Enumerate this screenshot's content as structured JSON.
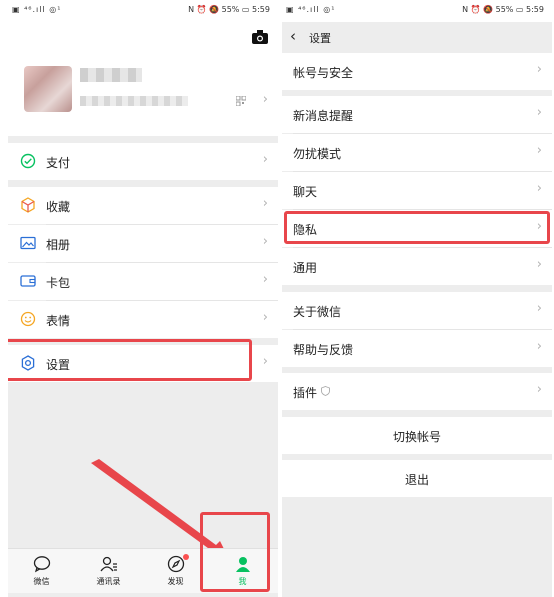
{
  "status": {
    "left_icons": "▣ ⁴⁶.ıll ◎¹",
    "right_text": "N ⏰ 🔕 55% ▭ 5:59"
  },
  "colors": {
    "wechat_green": "#07c160",
    "annotation_red": "#e8464b",
    "chevron_gray": "#b2b2b2",
    "badge_red": "#fa5151"
  },
  "me_page": {
    "menu": [
      {
        "label": "支付",
        "icon": "pay-icon"
      },
      {
        "label": "收藏",
        "icon": "favorites-icon"
      },
      {
        "label": "相册",
        "icon": "album-icon"
      },
      {
        "label": "卡包",
        "icon": "card-wallet-icon"
      },
      {
        "label": "表情",
        "icon": "sticker-icon"
      },
      {
        "label": "设置",
        "icon": "settings-icon"
      }
    ],
    "tabs": [
      {
        "label": "微信",
        "icon": "chat-bubble-icon"
      },
      {
        "label": "通讯录",
        "icon": "contacts-icon"
      },
      {
        "label": "发现",
        "icon": "compass-icon"
      },
      {
        "label": "我",
        "icon": "me-person-icon"
      }
    ]
  },
  "settings_page": {
    "title": "设置",
    "items": [
      {
        "label": "帐号与安全"
      },
      {
        "label": "新消息提醒"
      },
      {
        "label": "勿扰模式"
      },
      {
        "label": "聊天"
      },
      {
        "label": "隐私"
      },
      {
        "label": "通用"
      },
      {
        "label": "关于微信"
      },
      {
        "label": "帮助与反馈"
      },
      {
        "label": "插件"
      }
    ],
    "switch_account": "切换帐号",
    "logout": "退出"
  }
}
